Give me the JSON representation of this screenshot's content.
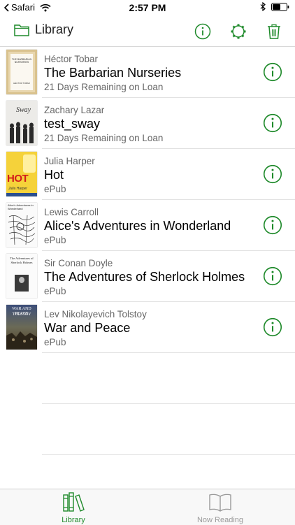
{
  "status_bar": {
    "back_app": "Safari",
    "time": "2:57 PM"
  },
  "nav": {
    "title": "Library"
  },
  "colors": {
    "accent": "#1f8a2b",
    "inactive": "#9a9a9a"
  },
  "books": [
    {
      "author": "Héctor Tobar",
      "title": "The Barbarian Nurseries",
      "subtitle": "21 Days Remaining on Loan"
    },
    {
      "author": "Zachary Lazar",
      "title": "test_sway",
      "subtitle": "21 Days Remaining on Loan"
    },
    {
      "author": "Julia Harper",
      "title": "Hot",
      "subtitle": "ePub"
    },
    {
      "author": "Lewis Carroll",
      "title": "Alice's Adventures in Wonderland",
      "subtitle": "ePub"
    },
    {
      "author": "Sir Conan Doyle",
      "title": "The Adventures of Sherlock Holmes",
      "subtitle": "ePub"
    },
    {
      "author": "Lev Nikolayevich Tolstoy",
      "title": "War and Peace",
      "subtitle": "ePub"
    }
  ],
  "covers": {
    "barbarian_title": "THE BARBARIAN NURSERIES",
    "barbarian_author": "HÉCTOR TOBAR",
    "sway_title": "Sway",
    "hot_title": "HOT",
    "hot_author": "Julia Harper",
    "alice_title": "Alice's Adventures in Wonderland",
    "sherlock_title": "The Adventures of Sherlock Holmes",
    "war_title": "WAR AND PEACE",
    "war_author": "TOLSTOY"
  },
  "tabs": [
    {
      "label": "Library"
    },
    {
      "label": "Now Reading"
    }
  ]
}
